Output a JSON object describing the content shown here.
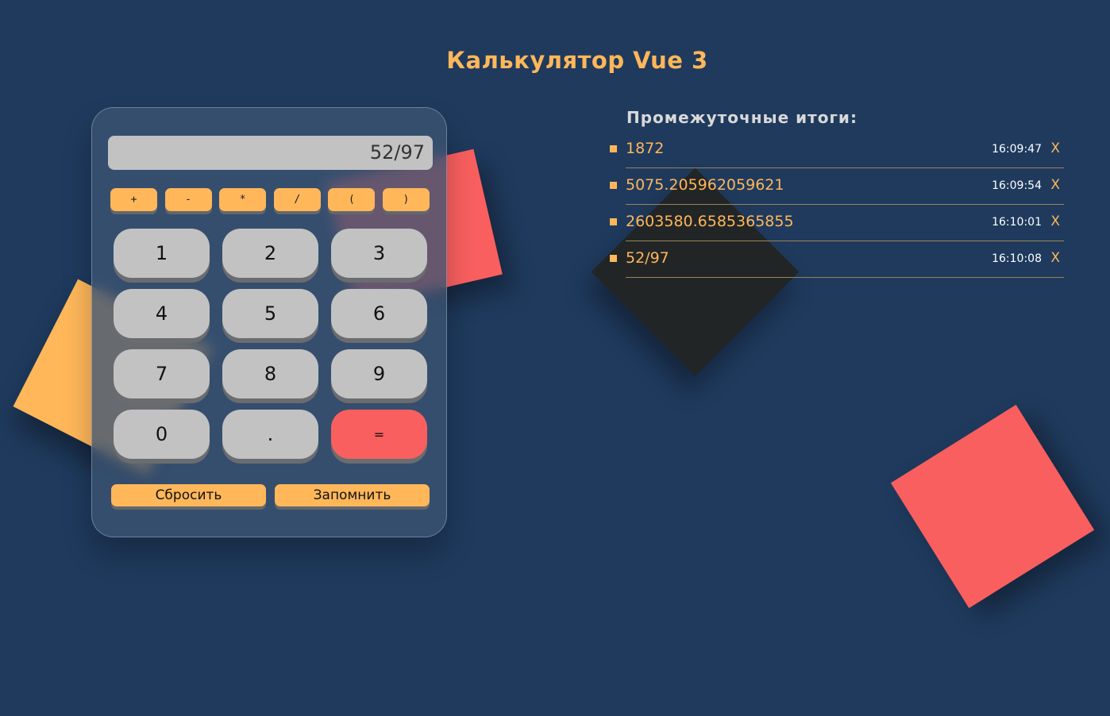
{
  "page": {
    "title": "Калькулятор Vue 3"
  },
  "calculator": {
    "display": "52/97",
    "operators": [
      "+",
      "-",
      "*",
      "/",
      "(",
      ")"
    ],
    "keys": [
      "1",
      "2",
      "3",
      "4",
      "5",
      "6",
      "7",
      "8",
      "9",
      "0",
      ".",
      "="
    ],
    "reset_label": "Сбросить",
    "remember_label": "Запомнить"
  },
  "history": {
    "title": "Промежуточные итоги:",
    "items": [
      {
        "value": "1872",
        "time": "16:09:47",
        "delete": "X"
      },
      {
        "value": "5075.205962059621",
        "time": "16:09:54",
        "delete": "X"
      },
      {
        "value": "2603580.6585365855",
        "time": "16:10:01",
        "delete": "X"
      },
      {
        "value": "52/97",
        "time": "16:10:08",
        "delete": "X"
      }
    ]
  },
  "colors": {
    "background": "#1f3a5d",
    "accent": "#ffb75a",
    "danger": "#f95f5f",
    "key": "#c2c2c2",
    "dark_shape": "#222526"
  }
}
